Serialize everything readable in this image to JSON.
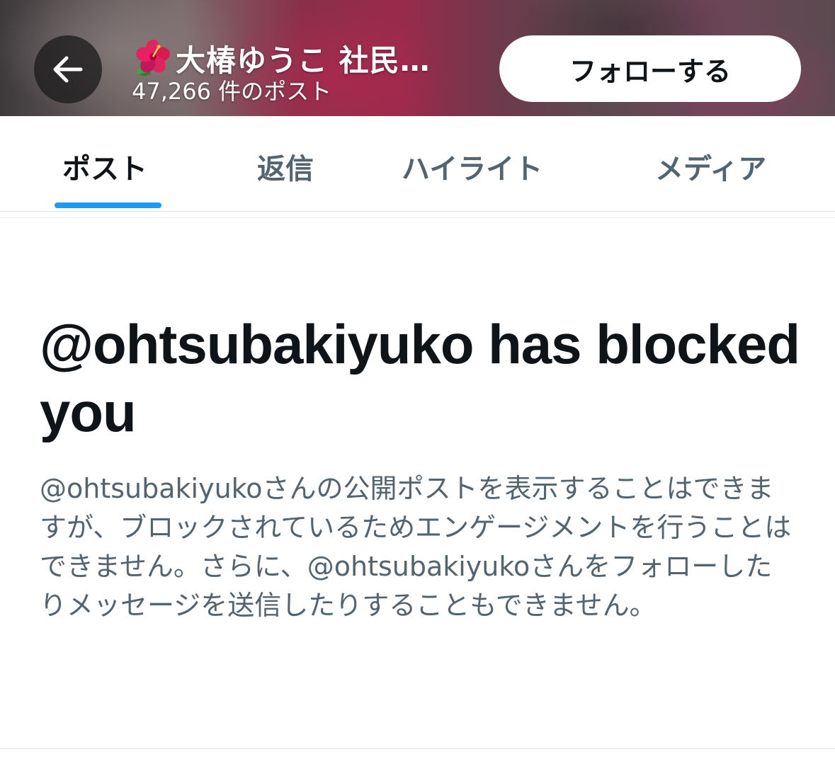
{
  "header": {
    "back_icon": "arrow-left-icon",
    "flower_icon": "hibiscus-icon",
    "profile_name": "大椿ゆうこ 社民…",
    "post_count": "47,266 件のポスト",
    "follow_label": "フォローする"
  },
  "tabs": [
    {
      "label": "ポスト",
      "active": true
    },
    {
      "label": "返信",
      "active": false
    },
    {
      "label": "ハイライト",
      "active": false
    },
    {
      "label": "メディア",
      "active": false
    }
  ],
  "blocked": {
    "title": "@ohtsubakiyuko has blocked you",
    "description": "@ohtsubakiyukoさんの公開ポストを表示することはできますが、ブロックされているためエンゲージメントを行うことはできません。さらに、@ohtsubakiyukoさんをフォローしたりメッセージを送信したりすることもできません。"
  },
  "colors": {
    "accent": "#1d9bf0",
    "text_primary": "#0f1419",
    "text_secondary": "#536471"
  }
}
